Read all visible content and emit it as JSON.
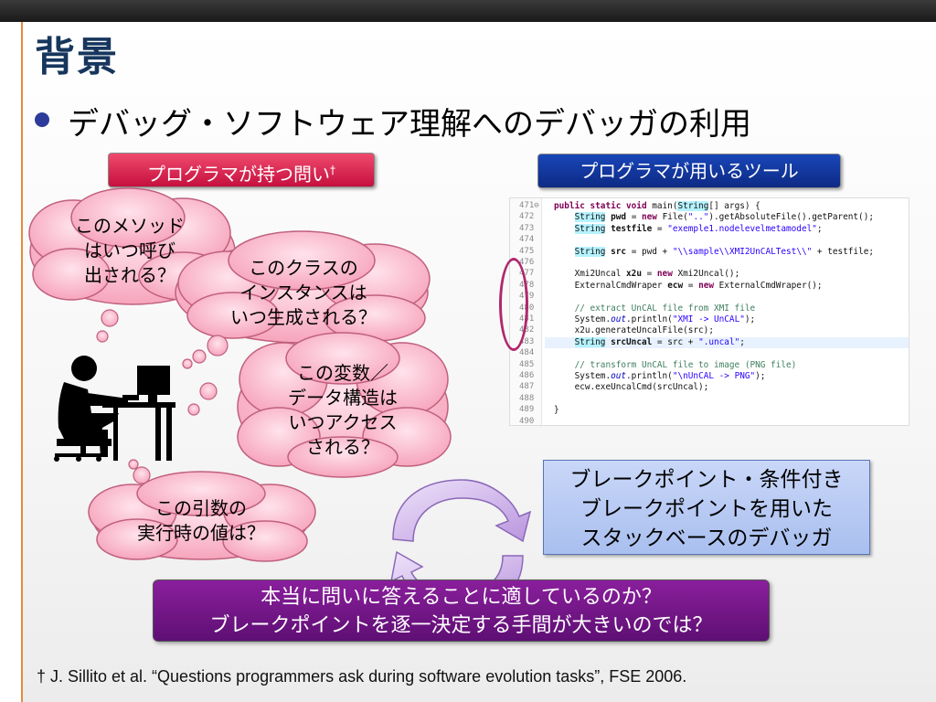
{
  "slide": {
    "title": "背景",
    "bullet": "デバッグ・ソフトウェア理解へのデバッガの利用"
  },
  "labels": {
    "questions_label": "プログラマが持つ問い",
    "questions_dagger": "†",
    "tools_label": "プログラマが用いるツール"
  },
  "clouds": [
    {
      "text": "このメソッド\nはいつ呼び\n出される？"
    },
    {
      "text": "このクラスの\nインスタンスは\nいつ生成される？"
    },
    {
      "text": "この変数／\nデータ構造は\nいつアクセス\nされる？"
    },
    {
      "text": "この引数の\n実行時の値は？"
    }
  ],
  "code": {
    "lines": [
      {
        "n": "471⊖",
        "html": "<span class=\"kw\">public static void</span> main(<span class=\"ty\">String</span>[] args) {"
      },
      {
        "n": "472",
        "html": "    <span class=\"ty\">String</span> <b>pwd</b> = <span class=\"kw\">new</span> File(<span class=\"str\">\"..\"</span>).getAbsoluteFile().getParent();"
      },
      {
        "n": "473",
        "html": "    <span class=\"ty\">String</span> <b>testfile</b> = <span class=\"str\">\"exemple1.nodelevelmetamodel\"</span>;"
      },
      {
        "n": "474",
        "html": ""
      },
      {
        "n": "475",
        "html": "    <span class=\"ty\">String</span> <b>src</b> = pwd + <span class=\"str\">\"\\\\sample\\\\XMI2UnCALTest\\\\\"</span> + testfile;"
      },
      {
        "n": "476",
        "html": ""
      },
      {
        "n": "477",
        "html": "    Xmi2Uncal <b>x2u</b> = <span class=\"kw\">new</span> Xmi2Uncal();"
      },
      {
        "n": "478",
        "html": "    ExternalCmdWraper <b>ecw</b> = <span class=\"kw\">new</span> ExternalCmdWraper();"
      },
      {
        "n": "479",
        "html": ""
      },
      {
        "n": "480",
        "html": "    <span class=\"cm\">// extract UnCAL file from XMI file</span>"
      },
      {
        "n": "481",
        "html": "    System.<span class=\"it\">out</span>.println(<span class=\"str\">\"XMI -> UnCAL\"</span>);"
      },
      {
        "n": "482",
        "html": "    x2u.generateUncalFile(src);"
      },
      {
        "n": "483",
        "html": "    <span class=\"ty\">String</span> <b>srcUncal</b> = src + <span class=\"str\">\".uncal\"</span>;"
      },
      {
        "n": "484",
        "html": ""
      },
      {
        "n": "485",
        "html": "    <span class=\"cm\">// transform UnCAL file to image (PNG file)</span>"
      },
      {
        "n": "486",
        "html": "    System.<span class=\"it\">out</span>.println(<span class=\"str\">\"\\nUnCAL -> PNG\"</span>);"
      },
      {
        "n": "487",
        "html": "    ecw.exeUncalCmd(srcUncal);"
      },
      {
        "n": "488",
        "html": ""
      },
      {
        "n": "489",
        "html": "}"
      },
      {
        "n": "490",
        "html": ""
      }
    ],
    "highlight_line_index": 12
  },
  "tool_box": {
    "line1": "ブレークポイント・条件付き",
    "line2": "ブレークポイントを用いた",
    "line3": "スタックベースのデバッガ"
  },
  "question_box": {
    "line1": "本当に問いに答えることに適しているのか？",
    "line2": "ブレークポイントを逐一決定する手間が大きいのでは？"
  },
  "footnote": "† J. Sillito et al. “Questions programmers ask during software evolution tasks”, FSE 2006.",
  "colors": {
    "title": "#17365d",
    "label_red": "#d81b4a",
    "label_blue": "#13389e",
    "cloud_fill": "#f9b7c9",
    "tool_box": "#b9cbf3",
    "question_box": "#74178a",
    "cycle_arrow": "#c9a8e4"
  }
}
